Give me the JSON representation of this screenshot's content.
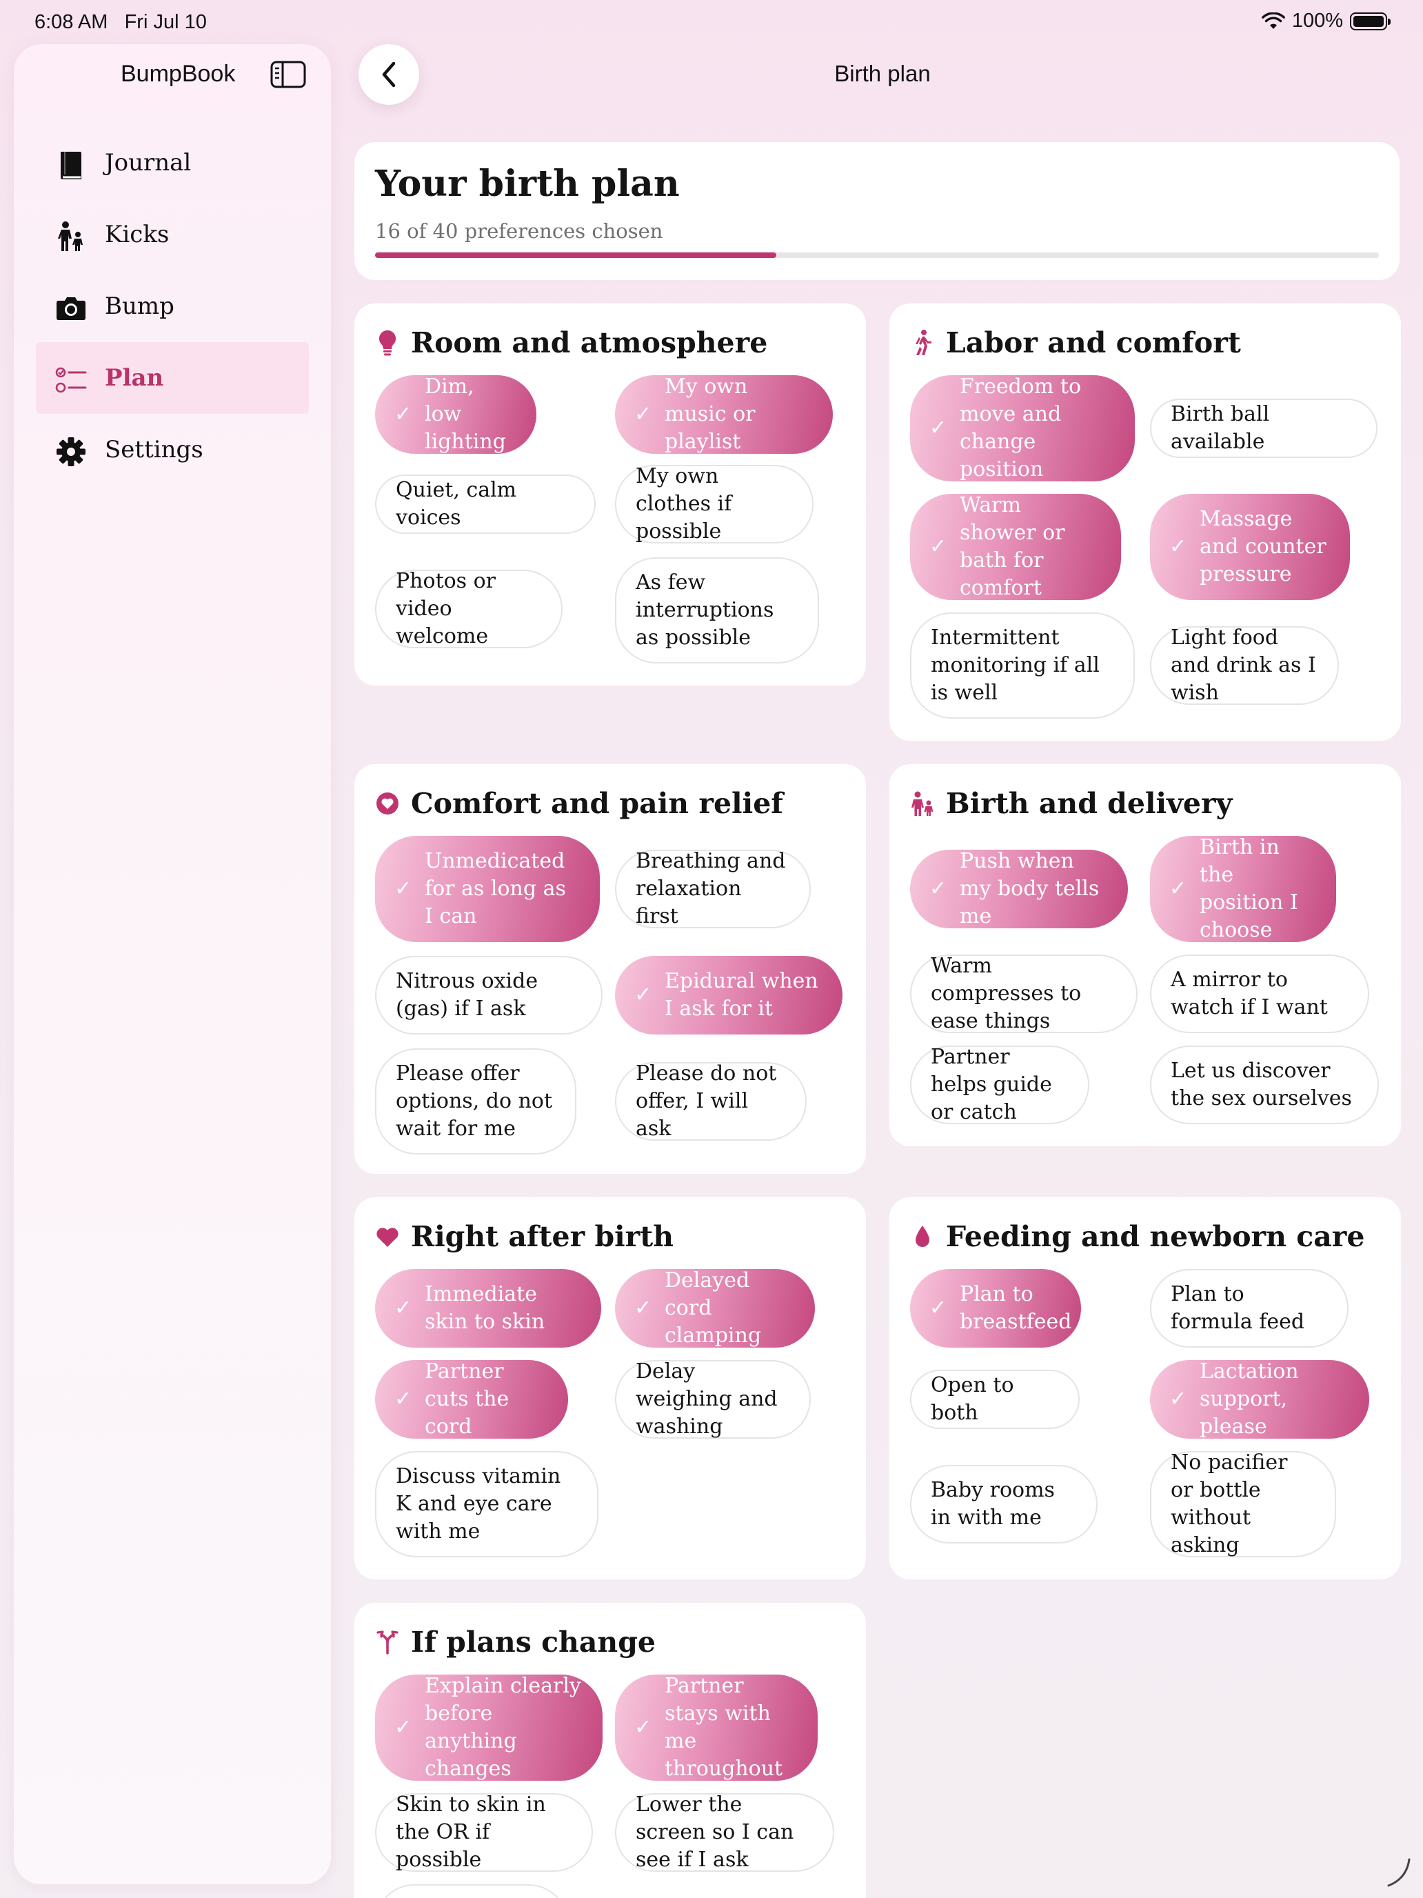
{
  "status_bar": {
    "time": "6:08 AM",
    "date": "Fri Jul 10",
    "battery": "100%"
  },
  "sidebar": {
    "title": "BumpBook",
    "items": [
      {
        "label": "Journal",
        "icon": "book-icon"
      },
      {
        "label": "Kicks",
        "icon": "walking-figures-icon"
      },
      {
        "label": "Bump",
        "icon": "camera-icon"
      },
      {
        "label": "Plan",
        "icon": "checklist-icon",
        "active": true
      },
      {
        "label": "Settings",
        "icon": "gear-icon"
      }
    ]
  },
  "header": {
    "title": "Birth plan"
  },
  "summary": {
    "title": "Your birth plan",
    "subtitle": "16 of 40 preferences chosen",
    "chosen": 16,
    "total": 40
  },
  "colors": {
    "accent": "#c0356f",
    "selected_gradient_start": "#f7c6dc",
    "selected_gradient_end": "#c4487f"
  },
  "sections": {
    "room": {
      "title": "Room and atmosphere",
      "icon": "lightbulb-icon",
      "chips": [
        {
          "label": "Dim, low lighting",
          "selected": true
        },
        {
          "label": "My own music or playlist",
          "selected": true
        },
        {
          "label": "Quiet, calm voices",
          "selected": false
        },
        {
          "label": "My own clothes if possible",
          "selected": false
        },
        {
          "label": "Photos or video welcome",
          "selected": false
        },
        {
          "label": "As few interruptions as possible",
          "selected": false
        }
      ]
    },
    "labor": {
      "title": "Labor and comfort",
      "icon": "walking-person-icon",
      "chips": [
        {
          "label": "Freedom to move and change position",
          "selected": true
        },
        {
          "label": "Birth ball available",
          "selected": false
        },
        {
          "label": "Warm shower or bath for comfort",
          "selected": true
        },
        {
          "label": "Massage and counter pressure",
          "selected": true
        },
        {
          "label": "Intermittent monitoring if all is well",
          "selected": false
        },
        {
          "label": "Light food and drink as I wish",
          "selected": false
        }
      ]
    },
    "pain": {
      "title": "Comfort and pain relief",
      "icon": "heart-circle-icon",
      "chips": [
        {
          "label": "Unmedicated for as long as I can",
          "selected": true
        },
        {
          "label": "Breathing and relaxation first",
          "selected": false
        },
        {
          "label": "Nitrous oxide (gas) if I ask",
          "selected": false
        },
        {
          "label": "Epidural when I ask for it",
          "selected": true
        },
        {
          "label": "Please offer options, do not wait for me",
          "selected": false
        },
        {
          "label": "Please do not offer, I will ask",
          "selected": false
        }
      ]
    },
    "delivery": {
      "title": "Birth and delivery",
      "icon": "parent-child-icon",
      "chips": [
        {
          "label": "Push when my body tells me",
          "selected": true
        },
        {
          "label": "Birth in the position I choose",
          "selected": true
        },
        {
          "label": "Warm compresses to ease things",
          "selected": false
        },
        {
          "label": "A mirror to watch if I want",
          "selected": false
        },
        {
          "label": "Partner helps guide or catch",
          "selected": false
        },
        {
          "label": "Let us discover the sex ourselves",
          "selected": false
        }
      ]
    },
    "after": {
      "title": "Right after birth",
      "icon": "heart-icon",
      "chips": [
        {
          "label": "Immediate skin to skin",
          "selected": true
        },
        {
          "label": "Delayed cord clamping",
          "selected": true
        },
        {
          "label": "Partner cuts the cord",
          "selected": true
        },
        {
          "label": "Delay weighing and washing",
          "selected": false
        },
        {
          "label": "Discuss vitamin K and eye care with me",
          "selected": false
        }
      ]
    },
    "feeding": {
      "title": "Feeding and newborn care",
      "icon": "drop-icon",
      "chips": [
        {
          "label": "Plan to breastfeed",
          "selected": true
        },
        {
          "label": "Plan to formula feed",
          "selected": false
        },
        {
          "label": "Open to both",
          "selected": false
        },
        {
          "label": "Lactation support, please",
          "selected": true
        },
        {
          "label": "Baby rooms in with me",
          "selected": false
        },
        {
          "label": "No pacifier or bottle without asking",
          "selected": false
        }
      ]
    },
    "change": {
      "title": "If plans change",
      "icon": "branch-icon",
      "chips": [
        {
          "label": "Explain clearly before anything changes",
          "selected": true
        },
        {
          "label": "Partner stays with me throughout",
          "selected": true
        },
        {
          "label": "Skin to skin in the OR if possible",
          "selected": false
        },
        {
          "label": "Lower the screen so I can see if I ask",
          "selected": false
        }
      ]
    }
  }
}
